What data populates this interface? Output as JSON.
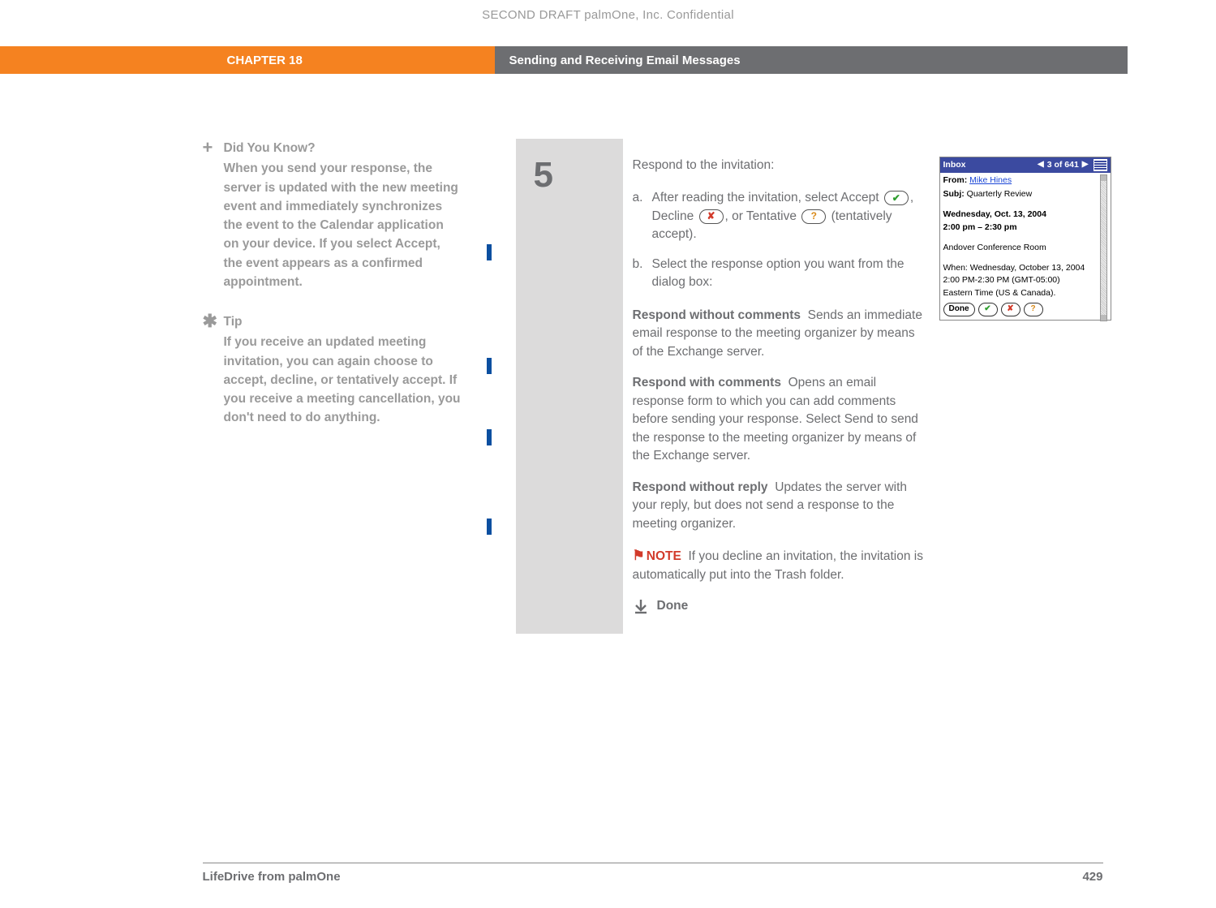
{
  "header": {
    "watermark": "SECOND DRAFT palmOne, Inc.  Confidential",
    "chapter_label": "CHAPTER 18",
    "chapter_title": "Sending and Receiving Email Messages"
  },
  "sidebar": {
    "blocks": [
      {
        "icon": "+",
        "title": "Did You Know?",
        "text": "When you send your response, the server is updated with the new meeting event and immediately synchronizes the event to the Calendar application on your device. If you select Accept, the event appears as a confirmed appointment."
      },
      {
        "icon": "✱",
        "title": "Tip",
        "text": "If you receive an updated meeting invitation, you can again choose to accept, decline, or tentatively accept. If you receive a meeting cancellation, you don't need to do anything."
      }
    ]
  },
  "step": {
    "number": "5",
    "heading": "Respond to the invitation:",
    "items": [
      {
        "letter": "a.",
        "pre": "After reading the invitation, select Accept ",
        "mid1": ", Decline ",
        "mid2": ", or Tentative ",
        "post": " (tentatively accept)."
      },
      {
        "letter": "b.",
        "text": "Select the response option you want from the dialog box:"
      }
    ],
    "options": [
      {
        "label": "Respond without comments",
        "desc": "Sends an immediate email response to the meeting organizer by means of the Exchange server."
      },
      {
        "label": "Respond with comments",
        "desc": "Opens an email response form to which you can add comments before sending your response. Select Send to send the response to the meeting organizer by means of the Exchange server."
      },
      {
        "label": "Respond without reply",
        "desc": "Updates the server with your reply, but does not send a response to the meeting organizer."
      }
    ],
    "note": {
      "label": "NOTE",
      "text": "If you decline an invitation, the invitation is automatically put into the Trash folder."
    },
    "done": "Done"
  },
  "device": {
    "titlebar": {
      "label": "Inbox",
      "counter": "3 of 641"
    },
    "from_label": "From:",
    "from_value": "Mike Hines",
    "subj_label": "Subj:",
    "subj_value": "Quarterly Review",
    "date_line": "Wednesday, Oct. 13, 2004",
    "time_line": "2:00 pm – 2:30 pm",
    "location": "Andover Conference Room",
    "when_label": "When: Wednesday, October 13, 2004",
    "when_time": "2:00 PM-2:30 PM (GMT-05:00)",
    "tz": "Eastern Time (US & Canada).",
    "buttons": {
      "done": "Done",
      "accept": "✔",
      "decline": "✘",
      "tentative": "?"
    }
  },
  "footer": {
    "product": "LifeDrive from palmOne",
    "page": "429"
  }
}
